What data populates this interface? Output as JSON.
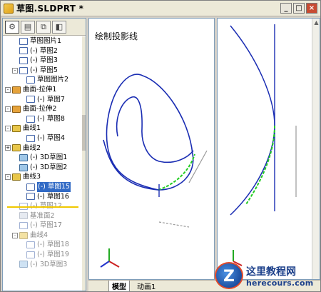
{
  "window": {
    "title": "草图.SLDPRT *",
    "controls": [
      "_",
      "□",
      "×"
    ]
  },
  "tree_tabs": [
    "feature-manager",
    "property-manager",
    "configuration-manager",
    "display-manager"
  ],
  "tree": [
    {
      "label": "草图图片1",
      "indent": 1,
      "icon": "sketch-picture",
      "state": "normal"
    },
    {
      "label": "(-) 草图2",
      "indent": 1,
      "icon": "sketch",
      "state": "normal"
    },
    {
      "label": "(-) 草图3",
      "indent": 1,
      "icon": "sketch",
      "state": "normal"
    },
    {
      "label": "(-) 草图5",
      "indent": 1,
      "icon": "sketch",
      "state": "normal",
      "expander": "-"
    },
    {
      "label": "草图图片2",
      "indent": 2,
      "icon": "sketch-picture",
      "state": "normal"
    },
    {
      "label": "曲面-拉伸1",
      "indent": 0,
      "icon": "feature",
      "state": "normal",
      "expander": "-"
    },
    {
      "label": "(-) 草图7",
      "indent": 2,
      "icon": "sketch",
      "state": "normal"
    },
    {
      "label": "曲面-拉伸2",
      "indent": 0,
      "icon": "feature",
      "state": "normal",
      "expander": "-"
    },
    {
      "label": "(-) 草图8",
      "indent": 2,
      "icon": "sketch",
      "state": "normal"
    },
    {
      "label": "曲线1",
      "indent": 0,
      "icon": "curve",
      "state": "normal",
      "expander": "-"
    },
    {
      "label": "(-) 草图4",
      "indent": 2,
      "icon": "sketch",
      "state": "normal"
    },
    {
      "label": "曲线2",
      "indent": 0,
      "icon": "curve",
      "state": "normal",
      "expander": "+"
    },
    {
      "label": "(-) 3D草图1",
      "indent": 1,
      "icon": "sketch3d",
      "state": "normal"
    },
    {
      "label": "(-) 3D草图2",
      "indent": 1,
      "icon": "sketch3d",
      "state": "normal"
    },
    {
      "label": "曲线3",
      "indent": 0,
      "icon": "curve",
      "state": "normal",
      "expander": "-"
    },
    {
      "label": "(-) 草图15",
      "indent": 2,
      "icon": "sketch",
      "state": "selected"
    },
    {
      "label": "(-) 草图16",
      "indent": 2,
      "icon": "sketch",
      "state": "normal"
    },
    {
      "label": "(-) 草图12",
      "indent": 1,
      "icon": "sketch",
      "state": "greyed"
    },
    {
      "label": "基准面2",
      "indent": 1,
      "icon": "plane",
      "state": "greyed"
    },
    {
      "label": "(-) 草图17",
      "indent": 1,
      "icon": "sketch",
      "state": "greyed"
    },
    {
      "label": "曲线4",
      "indent": 1,
      "icon": "curve",
      "state": "greyed",
      "expander": "-"
    },
    {
      "label": "(-) 草图18",
      "indent": 2,
      "icon": "sketch",
      "state": "greyed"
    },
    {
      "label": "(-) 草图19",
      "indent": 2,
      "icon": "sketch",
      "state": "greyed"
    },
    {
      "label": "(-) 3D草图3",
      "indent": 1,
      "icon": "sketch3d",
      "state": "greyed"
    }
  ],
  "viewport_left": {
    "title": "绘制投影线",
    "curve_color": "#1a2db3",
    "projected_color": "#22cc22"
  },
  "bottom_tabs": [
    "模型",
    "动画1"
  ],
  "active_tab": "模型",
  "watermark": {
    "logo_letter": "Z",
    "line1": "这里教程网",
    "line2": "herecours.com"
  },
  "colors": {
    "chrome": "#d4d0c8",
    "selection": "#316ac5",
    "curve_blue": "#1a2db3",
    "curve_green": "#22cc22",
    "rollback": "#f0c800"
  }
}
